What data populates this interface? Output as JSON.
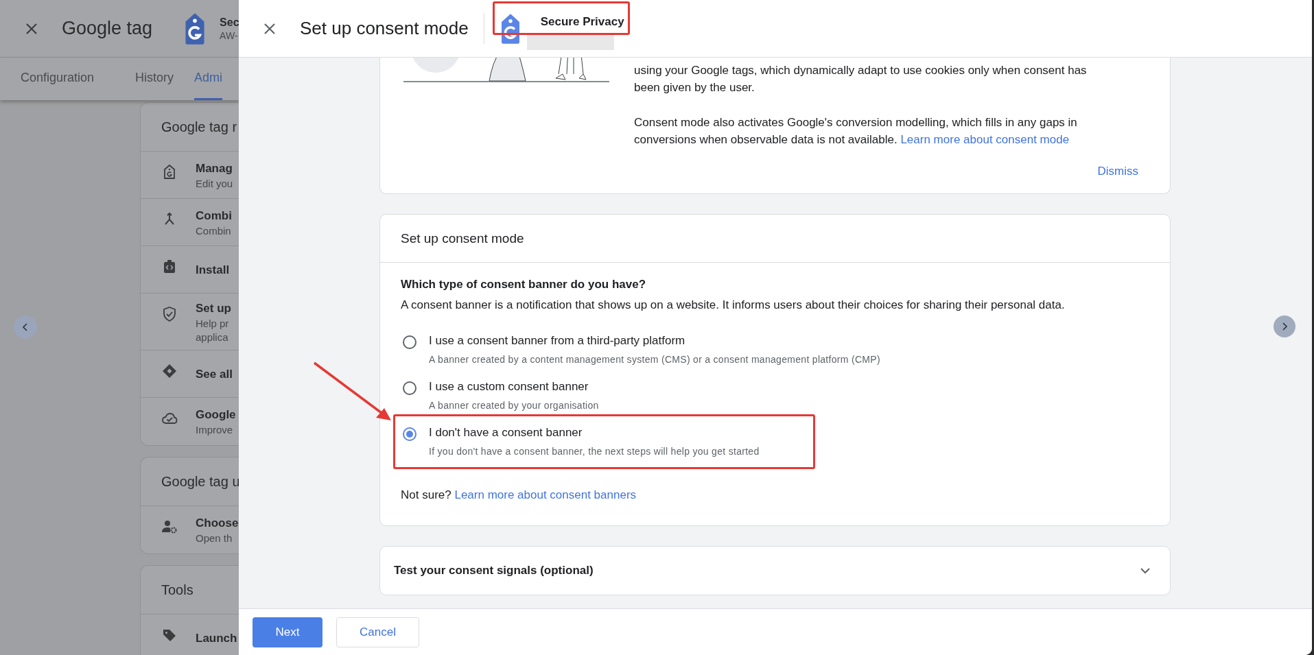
{
  "background_page": {
    "title": "Google tag",
    "tag_name": "Sec",
    "tag_id": "AW-",
    "tabs": [
      {
        "label": "Configuration",
        "selected": false
      },
      {
        "label": "History",
        "selected": false
      },
      {
        "label": "Admi",
        "selected": true
      }
    ],
    "sections": [
      {
        "title": "Google tag r",
        "items": [
          {
            "title": "Manag",
            "lines": [
              "Edit you"
            ]
          },
          {
            "title": "Combi",
            "lines": [
              "Combin"
            ]
          },
          {
            "title": "Install"
          },
          {
            "title": "Set up",
            "lines": [
              "Help pr",
              "applica"
            ]
          },
          {
            "title": "See all"
          },
          {
            "title": "Google",
            "lines": [
              "Improve"
            ]
          }
        ]
      },
      {
        "title": "Google tag u",
        "items": [
          {
            "title": "Choose",
            "lines": [
              "Open th"
            ]
          }
        ]
      },
      {
        "title": "Tools",
        "items": [
          {
            "title": "Launch"
          }
        ]
      }
    ]
  },
  "dialog": {
    "title": "Set up consent mode",
    "account_name": "Secure Privacy",
    "intro_card": {
      "paragraphs": [
        {
          "text": "using your Google tags, which dynamically adapt to use cookies only when consent has been given by the user."
        },
        {
          "text": "Consent mode also activates Google's conversion modelling, which fills in any gaps in conversions when observable data is not available. ",
          "link": "Learn more about consent mode"
        }
      ],
      "dismiss": "Dismiss"
    },
    "setup_card": {
      "title": "Set up consent mode",
      "question": "Which type of consent banner do you have?",
      "description": "A consent banner is a notification that shows up on a website. It informs users about their choices for sharing their personal data.",
      "options": [
        {
          "label": "I use a consent banner from a third-party platform",
          "description": "A banner created by a content management system (CMS) or a consent management platform (CMP)",
          "selected": false
        },
        {
          "label": "I use a custom consent banner",
          "description": "A banner created by your organisation",
          "selected": false
        },
        {
          "label": "I don't have a consent banner",
          "description": "If you don't have a consent banner, the next steps will help you get started",
          "selected": true
        }
      ],
      "not_sure": {
        "text": "Not sure?",
        "link": "Learn more about consent banners"
      }
    },
    "test_card": {
      "title": "Test your consent signals (optional)",
      "expanded": false
    },
    "buttons": [
      {
        "label": "Next",
        "kind": "primary"
      },
      {
        "label": "Cancel",
        "kind": "secondary"
      }
    ]
  }
}
